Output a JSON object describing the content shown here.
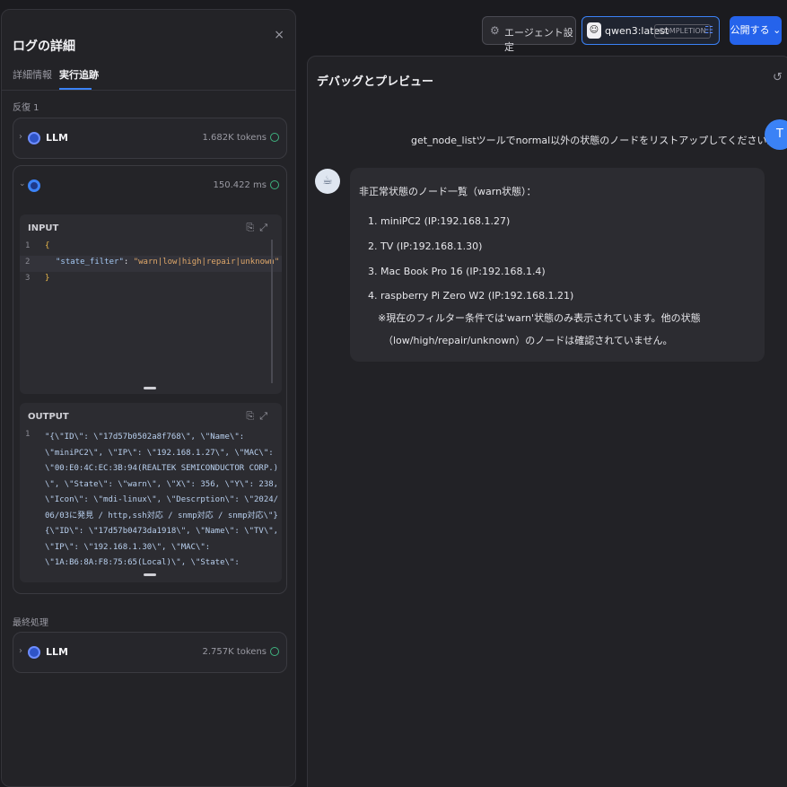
{
  "log_panel": {
    "title": "ログの詳細",
    "close": "×",
    "tabs": [
      {
        "label": "詳細情報",
        "active": false
      },
      {
        "label": "実行追跡",
        "active": true
      }
    ],
    "iteration_label": "反復 1",
    "final_label": "最終処理",
    "llm_first": {
      "name": "LLM",
      "tokens": "1.682K tokens"
    },
    "tool": {
      "duration": "150.422 ms"
    },
    "llm_last": {
      "name": "LLM",
      "tokens": "2.757K tokens"
    },
    "input": {
      "label": "INPUT",
      "line_numbers": [
        "1",
        "2",
        "3"
      ],
      "open": "{",
      "key": "\"state_filter\"",
      "colon": ": ",
      "value": "\"warn|low|high|repair|unknown\"",
      "close": "}"
    },
    "output": {
      "label": "OUTPUT",
      "line_number": "1",
      "lines": [
        "\"{\\\"ID\\\": \\\"17d57b0502a8f768\\\", \\\"Name\\\":",
        "\\\"miniPC2\\\", \\\"IP\\\": \\\"192.168.1.27\\\", \\\"MAC\\\":",
        "\\\"00:E0:4C:EC:3B:94(REALTEK SEMICONDUCTOR CORP.)",
        "\\\", \\\"State\\\": \\\"warn\\\", \\\"X\\\": 356, \\\"Y\\\": 238,",
        "\\\"Icon\\\": \\\"mdi-linux\\\", \\\"Descrption\\\": \\\"2024/",
        "06/03に発見 / http,ssh対応 / snmp対応 / snmp対応\\\"}",
        "{\\\"ID\\\": \\\"17d57b0473da1918\\\", \\\"Name\\\": \\\"TV\\\",",
        "\\\"IP\\\": \\\"192.168.1.30\\\", \\\"MAC\\\":",
        "\\\"1A:B6:8A:F8:75:65(Local)\\\", \\\"State\\\":"
      ]
    }
  },
  "header": {
    "agent_settings": "エージェント設定",
    "model_name": "qwen3:latest",
    "model_badge": "COMPLETION",
    "publish": "公開する"
  },
  "chat": {
    "title": "デバッグとプレビュー",
    "user_message": "get_node_listツールでnormal以外の状態のノードをリストアップしてください。",
    "user_initial": "T",
    "bot_lines": [
      "非正常状態のノード一覧（warn状態）：",
      "1. miniPC2 (IP:192.168.1.27)",
      "2. TV (IP:192.168.1.30)",
      "3. Mac Book Pro 16 (IP:192.168.1.4)",
      "4. raspberry Pi Zero W2 (IP:192.168.1.21)",
      "※現在のフィルター条件では'warn'状態のみ表示されています。他の状態",
      "（low/high/repair/unknown）のノードは確認されていません。"
    ]
  },
  "colors": {
    "accent": "#3b82f6",
    "success": "#3fb27f",
    "annotation_arrow": "#f05a4b"
  },
  "icons": [
    "close-icon",
    "chevron-right-icon",
    "chevron-down-icon",
    "llm-icon",
    "tool-icon",
    "check-circle-icon",
    "clipboard-icon",
    "expand-icon",
    "gear-icon",
    "settings-sliders-icon",
    "refresh-icon",
    "bot-avatar-icon",
    "annotation-arrow-icon"
  ]
}
